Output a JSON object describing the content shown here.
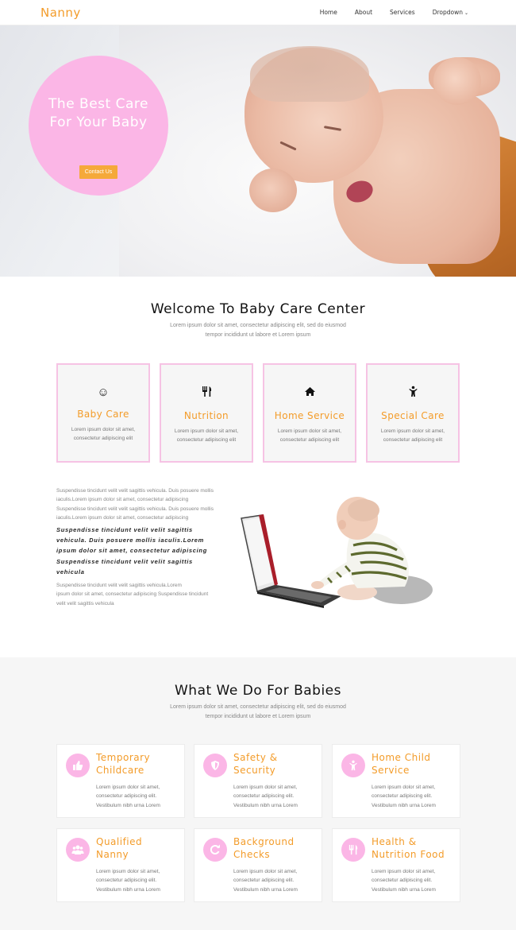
{
  "nav": {
    "brand": "Nanny",
    "links": [
      "Home",
      "About",
      "Services",
      "Dropdown"
    ]
  },
  "hero": {
    "title_line1": "The Best Care",
    "title_line2": "For Your Baby",
    "button": "Contact Us"
  },
  "welcome": {
    "title": "Welcome To Baby Care Center",
    "sub1": "Lorem ipsum dolor sit amet, consectetur adipiscing elit, sed do eiusmod",
    "sub2": "tempor incididunt ut labore et Lorem ipsum"
  },
  "cards": [
    {
      "icon": "smile-icon",
      "title": "Baby Care",
      "d1": "Lorem ipsum dolor sit amet,",
      "d2": "consectetur adipiscing elit"
    },
    {
      "icon": "cutlery-icon",
      "title": "Nutrition",
      "d1": "Lorem ipsum dolor sit amet,",
      "d2": "consectetur adipiscing elit"
    },
    {
      "icon": "home-icon",
      "title": "Home Service",
      "d1": "Lorem ipsum dolor sit amet,",
      "d2": "consectetur adipiscing elit"
    },
    {
      "icon": "child-icon",
      "title": "Special Care",
      "d1": "Lorem ipsum dolor sit amet,",
      "d2": "consectetur adipiscing elit"
    }
  ],
  "about": {
    "p1": [
      "Suspendisse tincidunt velit velit sagittis vehicula. Duis posuere mollis",
      "iaculis.Lorem ipsum dolor sit amet, consectetur adipiscing",
      "Suspendisse tincidunt velit velit sagittis vehicula. Duis posuere mollis",
      "iaculis.Lorem ipsum dolor sit amet, consectetur adipiscing"
    ],
    "em": [
      "Suspendisse tincidunt velit velit sagittis",
      "vehicula. Duis posuere mollis iaculis.Lorem",
      "ipsum dolor sit amet, consectetur adipiscing",
      "Suspendisse tincidunt velit velit sagittis",
      "vehicula"
    ],
    "p2": [
      "Suspendisse tincidunt velit velit sagittis vehicula.Lorem",
      "ipsum dolor sit amet, consectetur adipiscing Suspendisse tincidunt",
      "velit velit sagittis vehicula"
    ]
  },
  "services": {
    "title": "What We Do For Babies",
    "sub1": "Lorem ipsum dolor sit amet, consectetur adipiscing elit, sed do eiusmod",
    "sub2": "tempor incididunt ut labore et Lorem ipsum",
    "items": [
      {
        "icon": "thumbs-up-icon",
        "t1": "Temporary",
        "t2": "Childcare",
        "d": [
          "Lorem ipsum dolor sit amet,",
          "consectetur adipiscing elit.",
          "Vestibulum nibh urna Lorem"
        ]
      },
      {
        "icon": "shield-icon",
        "t1": "Safety &",
        "t2": "Security",
        "d": [
          "Lorem ipsum dolor sit amet,",
          "consectetur adipiscing elit.",
          "Vestibulum nibh urna Lorem"
        ]
      },
      {
        "icon": "child-icon",
        "t1": "Home Child",
        "t2": "Service",
        "d": [
          "Lorem ipsum dolor sit amet,",
          "consectetur adipiscing elit.",
          "Vestibulum nibh urna Lorem"
        ]
      },
      {
        "icon": "users-icon",
        "t1": "Qualified",
        "t2": "Nanny",
        "d": [
          "Lorem ipsum dolor sit amet,",
          "consectetur adipiscing elit.",
          "Vestibulum nibh urna Lorem"
        ]
      },
      {
        "icon": "refresh-icon",
        "t1": "Background",
        "t2": "Checks",
        "d": [
          "Lorem ipsum dolor sit amet,",
          "consectetur adipiscing elit.",
          "Vestibulum nibh urna Lorem"
        ]
      },
      {
        "icon": "cutlery-icon",
        "t1": "Health &",
        "t2": "Nutrition Food",
        "d": [
          "Lorem ipsum dolor sit amet,",
          "consectetur adipiscing elit.",
          "Vestibulum nibh urna Lorem"
        ]
      }
    ]
  },
  "colors": {
    "accent": "#f39c2a",
    "pink": "#fbb6e6",
    "button": "#f5a93a"
  }
}
